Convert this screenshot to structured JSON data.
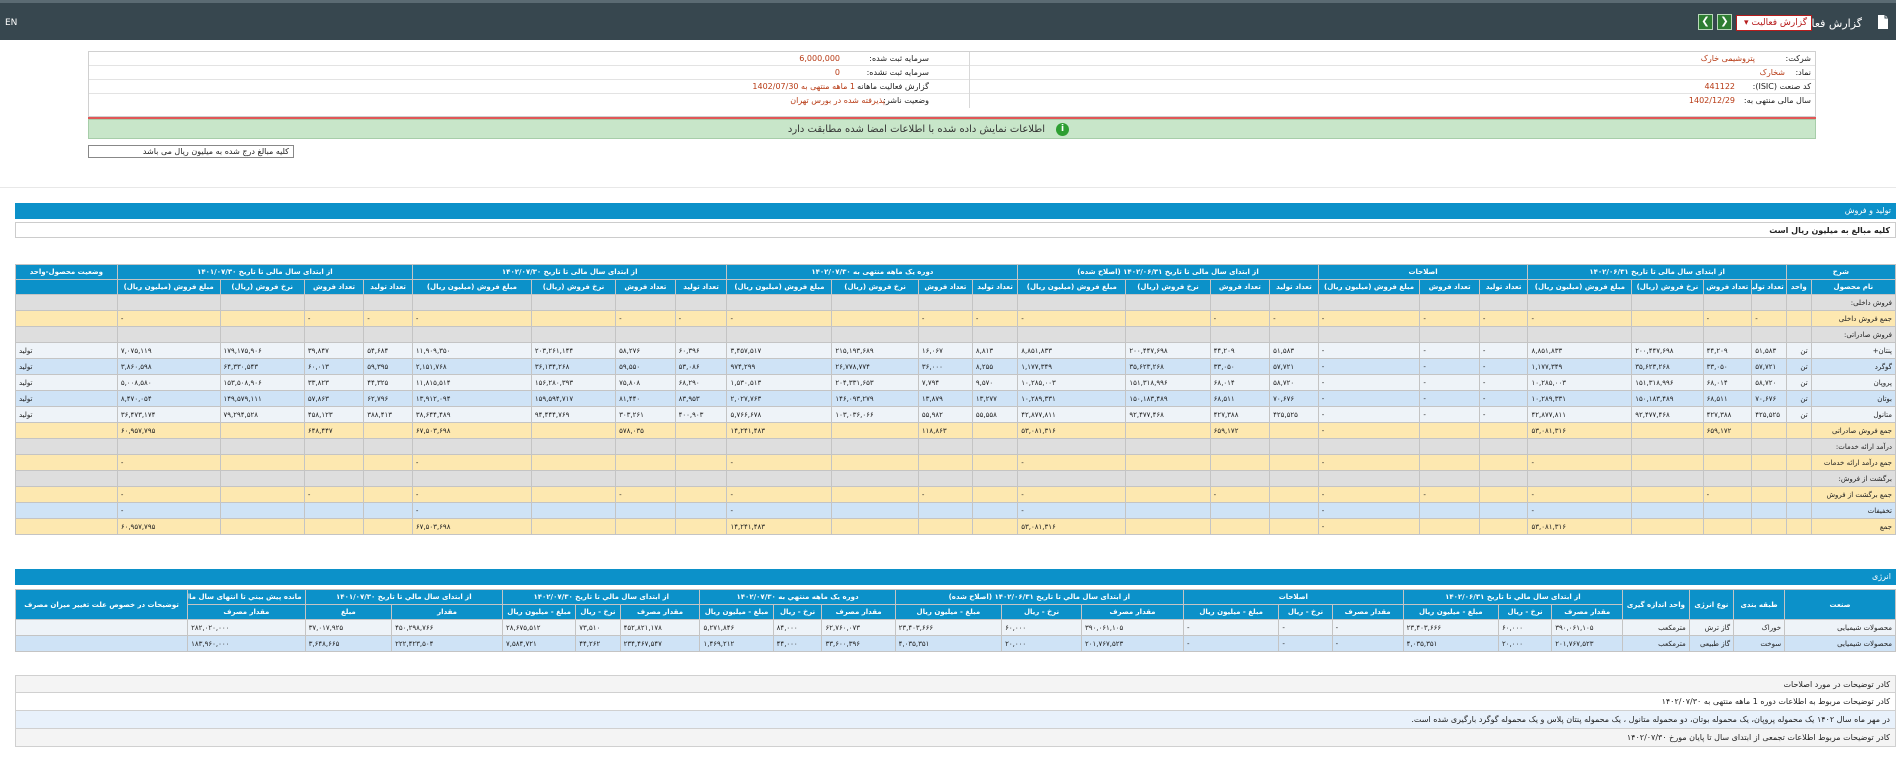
{
  "header": {
    "lang": "EN",
    "title": "گزارش فعالیت ماهانه",
    "select_value": "گزارش فعالیت",
    "prev_label": "❮",
    "next_label": "❯"
  },
  "info": {
    "company_label": "شرکت:",
    "company_value": "پتروشیمی خارک",
    "capital_label": "سرمایه ثبت شده:",
    "capital_value": "6,000,000",
    "symbol_label": "نماد:",
    "symbol_value": "شخارک",
    "unreg_capital_label": "سرمایه ثبت نشده:",
    "unreg_capital_value": "0",
    "isic_label": "کد صنعت (ISIC):",
    "isic_value": "441122",
    "period_label": "گزارش فعالیت ماهانه",
    "period_value": "1 ماهه منتهی به 1402/07/30",
    "fy_label": "سال مالی منتهی به:",
    "fy_value": "1402/12/29",
    "status_label": "وضعیت ناشر:",
    "status_value": "پذیرفته شده در بورس تهران",
    "notice": "اطلاعات نمایش داده شده با اطلاعات امضا شده مطابقت دارد",
    "units_note": "کلیه مبالغ درج شده به میلیون ریال می باشد"
  },
  "production": {
    "title": "تولید و فروش",
    "units_note": "کلیه مبالغ به میلیون ریال است",
    "groups": [
      "شرح",
      "از ابتدای سال مالی تا تاریخ ۱۴۰۲/۰۶/۳۱",
      "اصلاحات",
      "از ابتدای سال مالی تا تاریخ ۱۴۰۲/۰۶/۳۱ (اصلاح شده)",
      "دوره یک ماهه منتهی به ۱۴۰۲/۰۷/۳۰",
      "از ابتدای سال مالی تا تاریخ ۱۴۰۲/۰۷/۳۰",
      "از ابتدای سال مالی تا تاریخ ۱۴۰۱/۰۷/۳۰",
      "وضعیت محصول-واحد"
    ],
    "subheaders": [
      "نام محصول",
      "واحد",
      "تعداد تولید",
      "تعداد فروش",
      "نرخ فروش (ریال)",
      "مبلغ فروش (میلیون ریال)",
      "تعداد تولید",
      "تعداد فروش",
      "مبلغ فروش (میلیون ریال)",
      "تعداد تولید",
      "تعداد فروش",
      "نرخ فروش (ریال)",
      "مبلغ فروش (میلیون ریال)",
      "تعداد تولید",
      "تعداد فروش",
      "نرخ فروش (ریال)",
      "مبلغ فروش (میلیون ریال)",
      "تعداد تولید",
      "تعداد فروش",
      "نرخ فروش (ریال)",
      "مبلغ فروش (میلیون ریال)",
      "تعداد تولید",
      "تعداد فروش",
      "نرخ فروش (ریال)",
      "مبلغ فروش (میلیون ریال)",
      ""
    ],
    "rows": [
      {
        "style": "gray",
        "cells": [
          "فروش داخلی:",
          "",
          "",
          "",
          "",
          "",
          "",
          "",
          "",
          "",
          "",
          "",
          "",
          "",
          "",
          "",
          "",
          "",
          "",
          "",
          "",
          "",
          "",
          "",
          "",
          ""
        ]
      },
      {
        "style": "yellow",
        "cells": [
          "جمع فروش داخلی",
          "",
          "-",
          "-",
          "",
          "-",
          "-",
          "-",
          "-",
          "-",
          "-",
          "",
          "-",
          "-",
          "-",
          "",
          "-",
          "-",
          "-",
          "",
          "-",
          "-",
          "-",
          "",
          "-",
          ""
        ]
      },
      {
        "style": "gray",
        "cells": [
          "فروش صادراتی:",
          "",
          "",
          "",
          "",
          "",
          "",
          "",
          "",
          "",
          "",
          "",
          "",
          "",
          "",
          "",
          "",
          "",
          "",
          "",
          "",
          "",
          "",
          "",
          "",
          ""
        ]
      },
      {
        "style": "light",
        "cells": [
          "پنتان+",
          "تن",
          "۵۱,۵۸۳",
          "۴۴,۲۰۹",
          "۲۰۰,۴۴۷,۶۹۸",
          "۸,۸۵۱,۸۳۳",
          "-",
          "-",
          "-",
          "۵۱,۵۸۳",
          "۴۴,۲۰۹",
          "۲۰۰,۴۴۷,۶۹۸",
          "۸,۸۵۱,۸۳۳",
          "۸,۸۱۳",
          "۱۶,۰۶۷",
          "۲۱۵,۱۹۳,۶۸۹",
          "۳,۴۵۷,۵۱۷",
          "۶۰,۳۹۶",
          "۵۸,۲۷۶",
          "۲۰۳,۲۶۱,۱۴۴",
          "۱۱,۹۰۹,۳۵۰",
          "۵۴,۶۸۴",
          "۳۹,۸۴۷",
          "۱۷۹,۱۷۵,۹۰۶",
          "۷,۰۷۵,۱۱۹",
          "تولید"
        ]
      },
      {
        "style": "blue",
        "cells": [
          "گوگرد",
          "تن",
          "۵۷,۷۲۱",
          "۳۳,۰۵۰",
          "۳۵,۶۲۳,۲۶۸",
          "۱,۱۷۷,۳۴۹",
          "-",
          "-",
          "-",
          "۵۷,۷۲۱",
          "۳۳,۰۵۰",
          "۳۵,۶۲۳,۲۶۸",
          "۱,۱۷۷,۳۴۹",
          "۸,۲۵۵",
          "۳۶,۰۰۰",
          "۲۶,۷۷۸,۷۷۴",
          "۹۷۴,۲۹۹",
          "۵۳,۰۸۶",
          "۵۹,۵۵۰",
          "۳۶,۱۳۴,۲۶۸",
          "۲,۱۵۱,۷۶۸",
          "۵۹,۳۹۵",
          "۶۰,۰۱۳",
          "۶۴,۳۳۰,۵۴۳",
          "۳,۸۶۰,۵۹۸",
          "تولید"
        ]
      },
      {
        "style": "light",
        "cells": [
          "پروپان",
          "تن",
          "۵۸,۷۲۰",
          "۶۸,۰۱۴",
          "۱۵۱,۳۱۸,۹۹۶",
          "۱۰,۲۸۵,۰۰۳",
          "-",
          "-",
          "-",
          "۵۸,۷۲۰",
          "۶۸,۰۱۴",
          "۱۵۱,۳۱۸,۹۹۶",
          "۱۰,۲۸۵,۰۰۳",
          "۹,۵۷۰",
          "۷,۷۹۴",
          "۲۰۴,۳۳۱,۶۵۳",
          "۱,۵۳۰,۵۱۳",
          "۶۸,۲۹۰",
          "۷۵,۸۰۸",
          "۱۵۶,۲۸۰,۳۹۳",
          "۱۱,۸۱۵,۵۱۴",
          "۴۴,۳۲۵",
          "۳۳,۸۲۳",
          "۱۵۳,۵۰۸,۹۰۶",
          "۵,۰۰۸,۵۸۰",
          "تولید"
        ]
      },
      {
        "style": "blue",
        "cells": [
          "بوتان",
          "تن",
          "۷۰,۶۷۶",
          "۶۸,۵۱۱",
          "۱۵۰,۱۸۳,۴۸۹",
          "۱۰,۲۸۹,۳۳۱",
          "-",
          "-",
          "-",
          "۷۰,۶۷۶",
          "۶۸,۵۱۱",
          "۱۵۰,۱۸۳,۴۸۹",
          "۱۰,۲۸۹,۳۳۱",
          "۱۳,۲۷۷",
          "۱۳,۸۷۹",
          "۱۴۶,۰۹۳,۲۷۹",
          "۲,۰۲۷,۷۶۳",
          "۸۳,۹۵۳",
          "۸۱,۴۴۰",
          "۱۵۹,۵۹۴,۷۱۷",
          "۱۳,۹۱۲,۰۹۴",
          "۶۲,۷۹۶",
          "۵۷,۸۶۳",
          "۱۴۹,۵۷۹,۱۱۱",
          "۸,۴۷۰,۰۵۴",
          "تولید"
        ]
      },
      {
        "style": "light",
        "cells": [
          "متانول",
          "تن",
          "۴۲۵,۵۲۵",
          "۴۲۷,۳۸۸",
          "۹۲,۴۷۷,۴۶۸",
          "۴۲,۸۷۷,۸۱۱",
          "-",
          "-",
          "-",
          "۴۲۵,۵۲۵",
          "۴۲۷,۳۸۸",
          "۹۲,۴۷۷,۴۶۸",
          "۴۲,۸۷۷,۸۱۱",
          "۵۵,۵۵۸",
          "۵۵,۹۸۲",
          "۱۰۳,۰۳۶,۰۶۶",
          "۵,۷۶۶,۶۷۸",
          "۴۰۰,۹۰۳",
          "۳۰۳,۲۶۱",
          "۹۴,۴۴۴,۷۶۹",
          "۳۸,۶۴۴,۴۸۹",
          "۳۸۸,۴۱۳",
          "۴۵۸,۱۲۳",
          "۷۹,۲۹۴,۵۲۸",
          "۳۶,۴۷۳,۱۷۴",
          "تولید"
        ]
      },
      {
        "style": "yellow",
        "cells": [
          "جمع فروش صادراتی",
          "",
          "",
          "۶۵۹,۱۷۲",
          "",
          "۵۳,۰۸۱,۳۱۶",
          "",
          "",
          "-",
          "",
          "۶۵۹,۱۷۲",
          "",
          "۵۳,۰۸۱,۳۱۶",
          "",
          "۱۱۸,۸۶۳",
          "",
          "۱۴,۲۴۱,۴۸۳",
          "",
          "۵۷۸,۰۳۵",
          "",
          "۶۷,۵۰۳,۶۹۸",
          "",
          "۶۴۸,۴۴۷",
          "",
          "۶۰,۹۵۷,۷۹۵",
          ""
        ]
      },
      {
        "style": "gray",
        "cells": [
          "درآمد ارائه خدمات:",
          "",
          "",
          "",
          "",
          "",
          "",
          "",
          "",
          "",
          "",
          "",
          "",
          "",
          "",
          "",
          "",
          "",
          "",
          "",
          "",
          "",
          "",
          "",
          "",
          ""
        ]
      },
      {
        "style": "yellow",
        "cells": [
          "جمع درآمد ارائه خدمات",
          "",
          "",
          "",
          "",
          "-",
          "",
          "",
          "-",
          "",
          "",
          "",
          "-",
          "",
          "",
          "",
          "-",
          "",
          "",
          "",
          "-",
          "",
          "",
          "",
          "-",
          ""
        ]
      },
      {
        "style": "gray",
        "cells": [
          "برگشت از فروش:",
          "",
          "",
          "",
          "",
          "",
          "",
          "",
          "",
          "",
          "",
          "",
          "",
          "",
          "",
          "",
          "",
          "",
          "",
          "",
          "",
          "",
          "",
          "",
          "",
          ""
        ]
      },
      {
        "style": "yellow",
        "cells": [
          "جمع برگشت از فروش",
          "",
          "",
          "-",
          "",
          "-",
          "",
          "-",
          "-",
          "",
          "-",
          "",
          "-",
          "",
          "-",
          "",
          "-",
          "",
          "-",
          "",
          "-",
          "",
          "-",
          "",
          "-",
          ""
        ]
      },
      {
        "style": "blue",
        "cells": [
          "تخفیفات",
          "",
          "",
          "",
          "",
          "-",
          "",
          "",
          "-",
          "",
          "",
          "",
          "-",
          "",
          "",
          "",
          "-",
          "",
          "",
          "",
          "-",
          "",
          "",
          "",
          "-",
          ""
        ]
      },
      {
        "style": "yellow",
        "cells": [
          "جمع",
          "",
          "",
          "",
          "",
          "۵۳,۰۸۱,۳۱۶",
          "",
          "",
          "-",
          "",
          "",
          "",
          "۵۳,۰۸۱,۳۱۶",
          "",
          "",
          "",
          "۱۴,۲۴۱,۴۸۳",
          "",
          "",
          "",
          "۶۷,۵۰۳,۶۹۸",
          "",
          "",
          "",
          "۶۰,۹۵۷,۷۹۵",
          ""
        ]
      }
    ]
  },
  "energy": {
    "title": "انرژی",
    "groups": [
      "صنعت",
      "طبقه بندی",
      "نوع انرژی",
      "واحد اندازه گیری",
      "از ابتدای سال مالي تا تاريخ ۱۴۰۲/۰۶/۳۱",
      "اصلاحات",
      "از ابتدای سال مالي تا تاريخ ۱۴۰۲/۰۶/۳۱ (اصلاح شده)",
      "دوره يک ماهه منتهي به ۱۴۰۲/۰۷/۳۰",
      "از ابتدای سال مالي تا تاريخ ۱۴۰۲/۰۷/۳۰",
      "از ابتدای سال مالي تا تاريخ ۱۴۰۱/۰۷/۳۰",
      "مانده پيش بيني تا انتهای سال مالي ۱۴۰۲/۱۲/۲۹",
      "توضیحات در خصوص علت تغییر میزان مصرف"
    ],
    "subheaders": [
      "",
      "",
      "",
      "",
      "مقدار مصرف",
      "نرخ - ریال",
      "مبلغ - میلیون ریال",
      "مقدار مصرف",
      "نرخ - ریال",
      "مبلغ - میلیون ریال",
      "مقدار مصرف",
      "نرخ - ریال",
      "مبلغ - میلیون ریال",
      "مقدار مصرف",
      "نرخ - ریال",
      "مبلغ - میلیون ریال",
      "مقدار مصرف",
      "نرخ - ریال",
      "مبلغ - میلیون ریال",
      "مقدار",
      "مبلغ",
      "مقدار مصرف",
      ""
    ],
    "rows": [
      {
        "style": "e-light",
        "cells": [
          "محصولات شیمیایی",
          "خوراک",
          "گاز ترش",
          "مترمکعب",
          "۳۹۰,۰۶۱,۱۰۵",
          "۶۰,۰۰۰",
          "۲۳,۴۰۳,۶۶۶",
          "-",
          "-",
          "-",
          "۳۹۰,۰۶۱,۱۰۵",
          "۶۰,۰۰۰",
          "۲۳,۴۰۳,۶۶۶",
          "۶۲,۷۶۰,۰۷۳",
          "۸۴,۰۰۰",
          "۵,۲۷۱,۸۴۶",
          "۴۵۲,۸۲۱,۱۷۸",
          "۷۳,۵۱۰",
          "۲۸,۶۷۵,۵۱۲",
          "۴۵۰,۲۹۸,۷۶۶",
          "۳۷,۰۱۷,۹۲۵",
          "۲۸۲,۰۲۰,۰۰۰",
          ""
        ]
      },
      {
        "style": "e-blue",
        "cells": [
          "محصولات شیمیایی",
          "سوخت",
          "گاز طبیعی",
          "مترمکعب",
          "۲۰۱,۷۶۷,۵۲۳",
          "۲۰,۰۰۰",
          "۴,۰۳۵,۳۵۱",
          "-",
          "-",
          "-",
          "۲۰۱,۷۶۷,۵۲۳",
          "۲۰,۰۰۰",
          "۴,۰۳۵,۳۵۱",
          "۳۳,۶۰۰,۳۹۶",
          "۴۴,۰۰۰",
          "۱,۴۶۹,۲۱۲",
          "۲۳۴,۴۶۷,۵۴۷",
          "۴۴,۲۶۲",
          "۷,۵۸۴,۷۲۱",
          "۲۲۲,۴۲۳,۵۰۴",
          "۳,۶۴۸,۶۶۵",
          "۱۸۳,۹۶۰,۰۰۰",
          ""
        ]
      }
    ]
  },
  "notes": {
    "title": "کادر توضیحات در مورد اصلاحات",
    "line1": "کادر توضیحات مربوط به اطلاعات دوره 1 ماهه منتهی به ۱۴۰۲/۰۷/۳۰",
    "line2": "در مهر ماه سال ۱۴۰۲ یک محموله پروپان، یک محموله بوتان، دو محموله متانول ، یک محموله پنتان پلاس و یک محموله گوگرد بارگیری شده است.",
    "line3": "کادر توضیحات مربوط اطلاعات تجمعی از ابتدای سال تا پایان مورخ ۱۴۰۲/۰۷/۳۰"
  }
}
